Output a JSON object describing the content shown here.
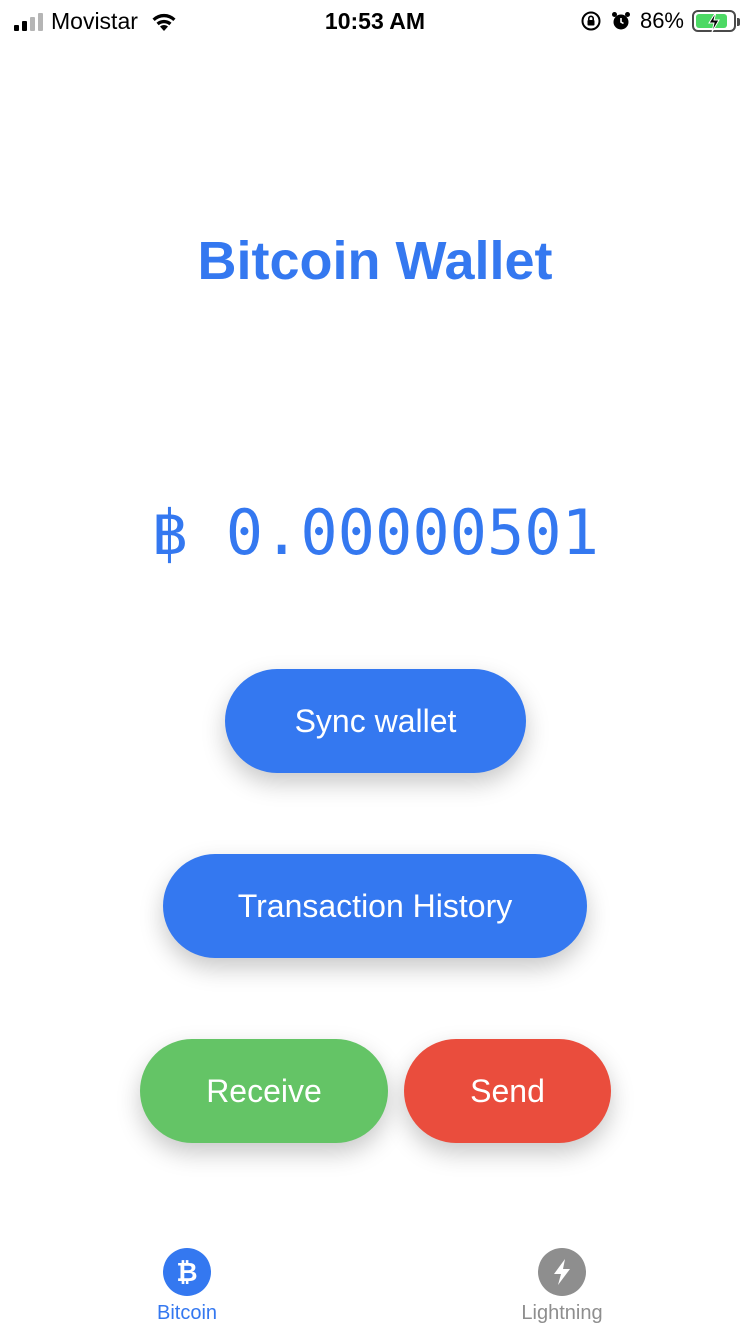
{
  "status_bar": {
    "carrier": "Movistar",
    "time": "10:53 AM",
    "battery_percent": "86%",
    "signal_bars": 2,
    "battery_level": 0.86,
    "icons": [
      "signal-icon",
      "wifi-icon",
      "orientation-lock-icon",
      "alarm-icon",
      "battery-charging-icon"
    ]
  },
  "title": "Bitcoin Wallet",
  "balance": {
    "symbol": "฿",
    "amount": "0.00000501"
  },
  "buttons": {
    "sync": "Sync wallet",
    "history": "Transaction History",
    "receive": "Receive",
    "send": "Send"
  },
  "tabs": [
    {
      "label": "Bitcoin",
      "icon": "bitcoin-icon",
      "glyph": "₿",
      "active": true
    },
    {
      "label": "Lightning",
      "icon": "lightning-icon",
      "active": false
    }
  ],
  "colors": {
    "accent": "#3478f0",
    "receive": "#64c466",
    "send": "#ea4d3d",
    "inactive": "#8e8e8e"
  }
}
